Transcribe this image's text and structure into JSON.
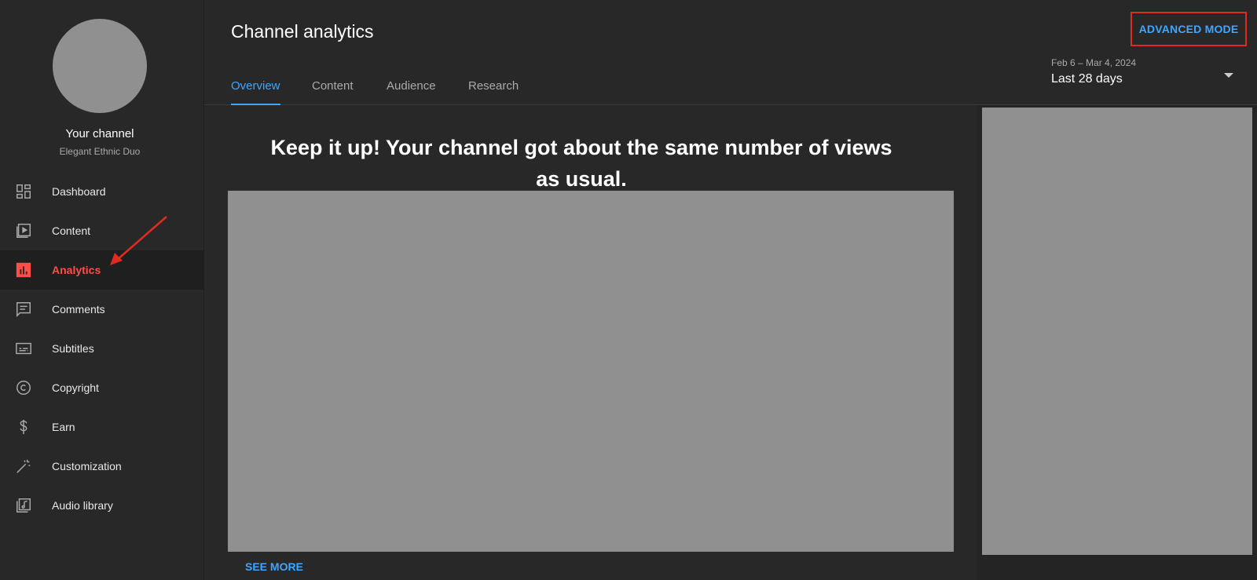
{
  "channel": {
    "title": "Your channel",
    "name": "Elegant Ethnic Duo"
  },
  "sidebar": {
    "items": [
      {
        "label": "Dashboard",
        "icon": "dashboard-icon",
        "active": false
      },
      {
        "label": "Content",
        "icon": "content-icon",
        "active": false
      },
      {
        "label": "Analytics",
        "icon": "analytics-icon",
        "active": true
      },
      {
        "label": "Comments",
        "icon": "comments-icon",
        "active": false
      },
      {
        "label": "Subtitles",
        "icon": "subtitles-icon",
        "active": false
      },
      {
        "label": "Copyright",
        "icon": "copyright-icon",
        "active": false
      },
      {
        "label": "Earn",
        "icon": "dollar-icon",
        "active": false
      },
      {
        "label": "Customization",
        "icon": "magic-wand-icon",
        "active": false
      },
      {
        "label": "Audio library",
        "icon": "audio-library-icon",
        "active": false
      }
    ]
  },
  "header": {
    "title": "Channel analytics",
    "advanced_mode": "ADVANCED MODE"
  },
  "tabs": [
    {
      "label": "Overview",
      "active": true
    },
    {
      "label": "Content",
      "active": false
    },
    {
      "label": "Audience",
      "active": false
    },
    {
      "label": "Research",
      "active": false
    }
  ],
  "date_range": {
    "dates": "Feb 6 – Mar 4, 2024",
    "period": "Last 28 days"
  },
  "main": {
    "headline": "Keep it up! Your channel got about the same number of views as usual.",
    "see_more": "SEE MORE"
  },
  "colors": {
    "accent": "#3ea6ff",
    "active_nav": "#ff4e45",
    "highlight_box": "#e02b20",
    "background": "#282828"
  }
}
